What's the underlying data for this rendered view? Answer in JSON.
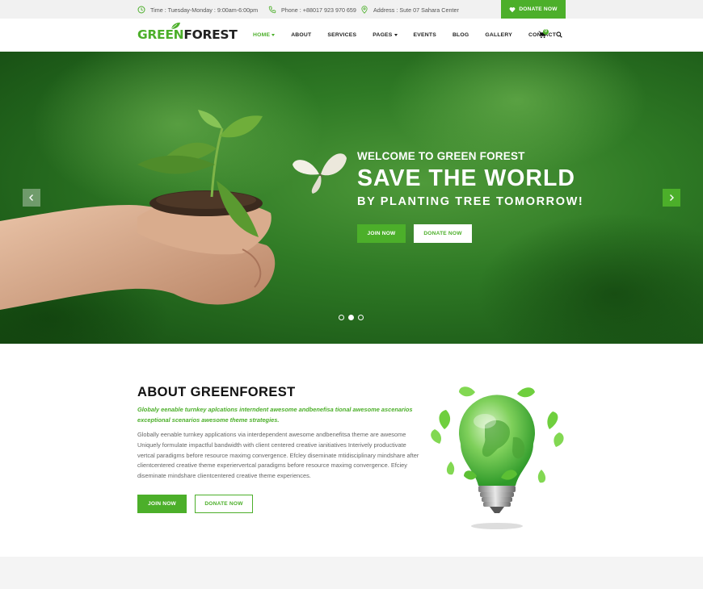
{
  "topbar": {
    "time": "Time :  Tuesday-Monday : 9:00am-6:00pm",
    "phone": "Phone : +88017 923 970 659",
    "address": "Address :  Sute 07 Sahara Center",
    "donate": "DONATE NOW"
  },
  "logo": {
    "part1": "GREEN",
    "part2": "FOREST"
  },
  "nav": {
    "items": [
      {
        "label": "HOME",
        "dropdown": true,
        "active": true
      },
      {
        "label": "ABOUT"
      },
      {
        "label": "SERVICES"
      },
      {
        "label": "PAGES",
        "dropdown": true
      },
      {
        "label": "EVENTS"
      },
      {
        "label": "BLOG"
      },
      {
        "label": "GALLERY"
      },
      {
        "label": "CONTACT"
      }
    ],
    "cart_count": "0"
  },
  "hero": {
    "welcome": "WELCOME TO GREEN FOREST",
    "headline": "SAVE THE WORLD",
    "subhead": "BY PLANTING TREE TOMORROW!",
    "join": "JOIN NOW",
    "donate": "DONATE NOW",
    "slides": 3,
    "active_slide": 2
  },
  "about": {
    "title": "ABOUT GREENFOREST",
    "lead": "Globaly eenable turnkey aplcations interndent awesome andbenefisa tional awesome ascenarios exceptional scenarios awesome theme strategies.",
    "body": "Globally eenable turnkey applications via interdependent awesome andbenefitsa theme are awesome Uniquely formulate impactful bandwidth with client centered creative ianitiatives Interively productivate vertcal paradigms before resource maximg convergence. Efcley diseminate mtidisciplinary mindshare after clientcentered creative theme experiervertcal paradigms before resource maximg convergence. Efciey diseminate mindshare clientcentered creative theme experiences.",
    "join": "JOIN NOW",
    "donate": "DONATE NOW"
  },
  "colors": {
    "accent": "#4caf2a",
    "topbar_bg": "#f1f1f1"
  }
}
